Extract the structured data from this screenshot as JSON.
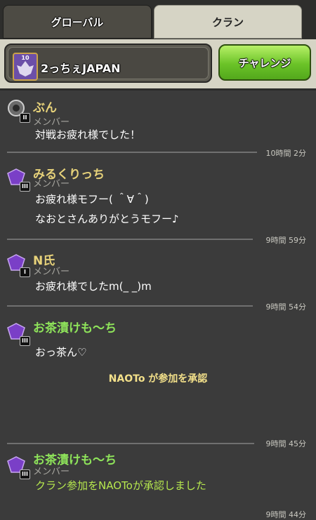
{
  "tabs": {
    "global": "グローバル",
    "clan": "クラン"
  },
  "clan": {
    "name": "2っちぇJAPAN",
    "level": "10"
  },
  "challenge_label": "チャレンジ",
  "messages": [
    {
      "name": "ぶん",
      "role": "メンバー",
      "rank": "II",
      "lines": [
        "対戦お疲れ様でした！"
      ],
      "time": "10時間 2分",
      "name_color": "#e7d27a"
    },
    {
      "name": "みるくりっち",
      "role": "メンバー",
      "rank": "III",
      "lines": [
        "お疲れ様モフー( ＾∀＾)",
        "なおとさんありがとうモフー♪"
      ],
      "time": "9時間 59分",
      "name_color": "#e7d27a"
    },
    {
      "name": "N氏",
      "role": "メンバー",
      "rank": "I",
      "lines": [
        "お疲れ様でしたm(_ _)m"
      ],
      "time": "9時間 54分",
      "name_color": "#e7d27a"
    },
    {
      "name": "お茶漬けも〜ち",
      "role": "",
      "rank": "III",
      "lines": [
        "おっ茶ん♡"
      ],
      "time": "9時間 45分",
      "name_color": "#8ee35a"
    },
    {
      "name": "お茶漬けも〜ち",
      "role": "メンバー",
      "rank": "III",
      "lines": [],
      "time": "9時間 44分",
      "name_color": "#8ee35a"
    }
  ],
  "system_notice": "NAOTo が参加を承認",
  "system_notice2": "クラン参加をNAOToが承認しました",
  "colors": {
    "accent_green": "#6bc328",
    "gold": "#e7d27a",
    "green_name": "#8ee35a"
  }
}
